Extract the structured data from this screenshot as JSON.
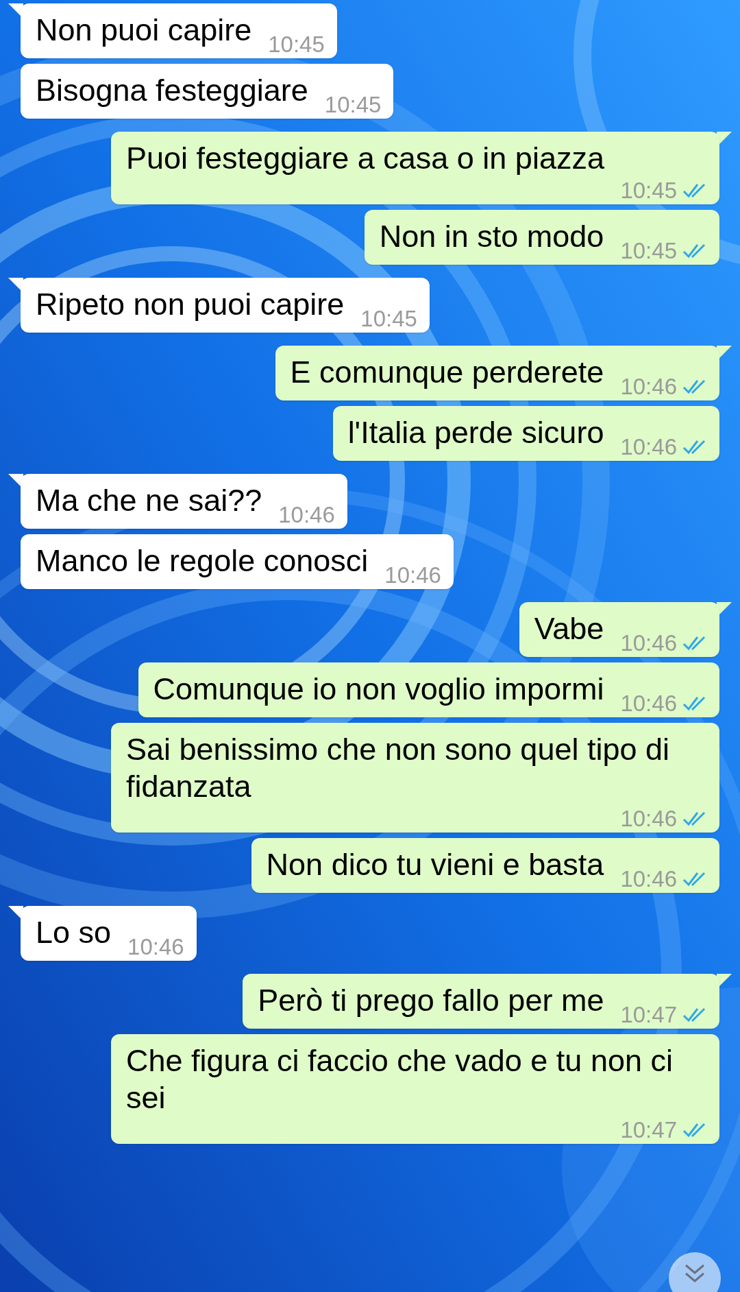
{
  "messages": [
    {
      "text": "Non puoi capire",
      "time": "10:45",
      "outgoing": false,
      "tail": true
    },
    {
      "text": "Bisogna festeggiare",
      "time": "10:45",
      "outgoing": false,
      "tail": false
    },
    {
      "text": "Puoi festeggiare a casa o in piazza",
      "time": "10:45",
      "outgoing": true,
      "tail": true,
      "read": true
    },
    {
      "text": "Non in sto modo",
      "time": "10:45",
      "outgoing": true,
      "tail": false,
      "read": true
    },
    {
      "text": "Ripeto non puoi capire",
      "time": "10:45",
      "outgoing": false,
      "tail": true
    },
    {
      "text": "E comunque perderete",
      "time": "10:46",
      "outgoing": true,
      "tail": true,
      "read": true
    },
    {
      "text": "l'Italia perde sicuro",
      "time": "10:46",
      "outgoing": true,
      "tail": false,
      "read": true
    },
    {
      "text": "Ma che ne sai??",
      "time": "10:46",
      "outgoing": false,
      "tail": true
    },
    {
      "text": "Manco le regole conosci",
      "time": "10:46",
      "outgoing": false,
      "tail": false
    },
    {
      "text": "Vabe",
      "time": "10:46",
      "outgoing": true,
      "tail": true,
      "read": true
    },
    {
      "text": "Comunque io non voglio impormi",
      "time": "10:46",
      "outgoing": true,
      "tail": false,
      "read": true
    },
    {
      "text": "Sai benissimo che non sono quel tipo di fidanzata",
      "time": "10:46",
      "outgoing": true,
      "tail": false,
      "read": true
    },
    {
      "text": "Non dico tu vieni e basta",
      "time": "10:46",
      "outgoing": true,
      "tail": false,
      "read": true
    },
    {
      "text": "Lo so",
      "time": "10:46",
      "outgoing": false,
      "tail": true
    },
    {
      "text": "Però ti prego fallo per me",
      "time": "10:47",
      "outgoing": true,
      "tail": true,
      "read": true
    },
    {
      "text": "Che figura ci faccio che vado e tu non ci sei",
      "time": "10:47",
      "outgoing": true,
      "tail": false,
      "read": true
    }
  ]
}
